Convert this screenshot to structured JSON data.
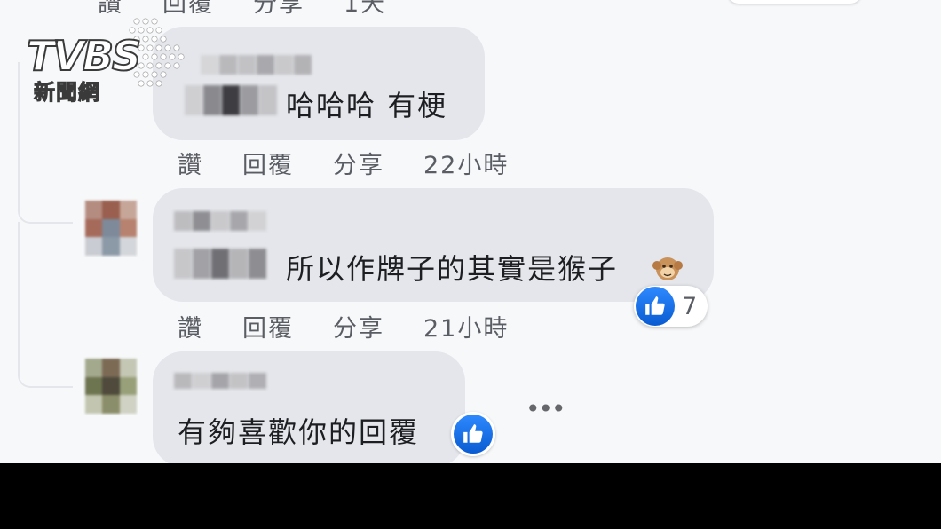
{
  "logo": {
    "brand": "TVBS",
    "subtitle": "新聞網"
  },
  "top_partial_actions": {
    "like": "讚",
    "reply": "回覆",
    "share": "分享",
    "time": "1天"
  },
  "comments": [
    {
      "text": "哈哈哈 有梗",
      "actions": {
        "like": "讚",
        "reply": "回覆",
        "share": "分享"
      },
      "time": "22小時"
    },
    {
      "text": "所以作牌子的其實是猴子",
      "emoji_icon": "monkey-icon",
      "reaction_count": "7",
      "actions": {
        "like": "讚",
        "reply": "回覆",
        "share": "分享"
      },
      "time": "21小時"
    },
    {
      "text": "有夠喜歡你的回覆",
      "more": "•••"
    }
  ],
  "colors": {
    "bubble": "#e4e6eb",
    "like_blue": "#1877f2",
    "meta_text": "#5a5d63",
    "background": "#f7f8fa"
  }
}
